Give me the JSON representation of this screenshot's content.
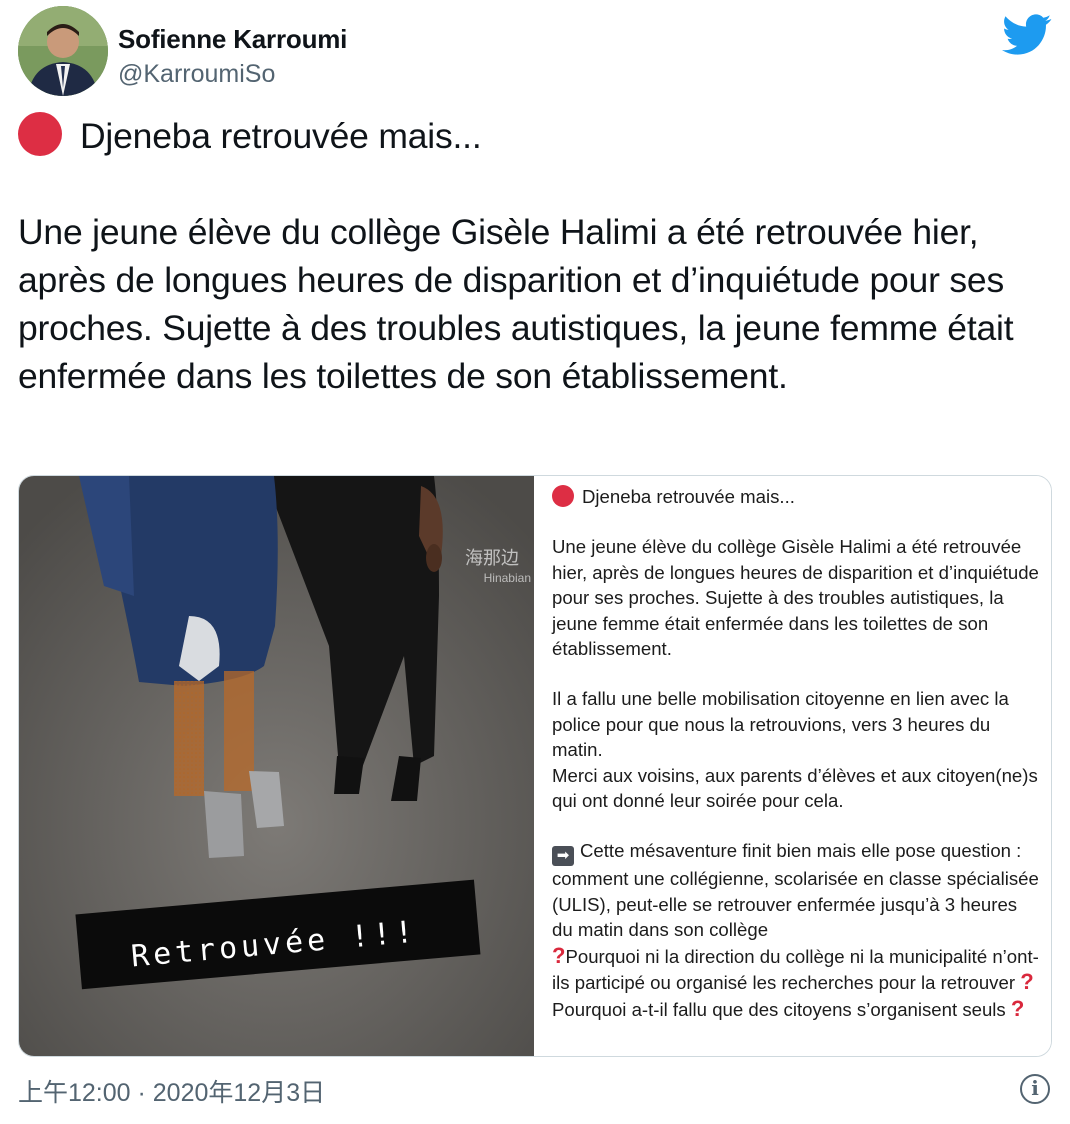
{
  "author": {
    "name": "Sofienne Karroumi",
    "handle": "@KarroumiSo"
  },
  "icons": {
    "logo": "twitter-bird-icon",
    "status": "red-circle-icon",
    "info": "info-icon"
  },
  "colors": {
    "twitter_blue": "#1d9bf0",
    "red_dot": "#dd2e44"
  },
  "tweet": {
    "line1": "Djeneba retrouvée mais...",
    "body": "Une jeune élève du collège Gisèle Halimi a été retrouvée hier, après de longues heures de disparition et d’inquiétude pour ses proches. Sujette à des troubles autistiques, la jeune femme était enfermée dans les toilettes de son établissement."
  },
  "media": {
    "photo_caption": "Retrouvée !!!",
    "watermark_cn": "海那边",
    "watermark_en": "Hinabian",
    "panel": {
      "title": "Djeneba retrouvée mais...",
      "p1": "Une jeune élève du collège Gisèle Halimi a été retrouvée hier, après de longues heures de disparition et d’inquiétude pour ses proches. Sujette à des troubles autistiques, la jeune femme était enfermée dans les toilettes de son établissement.",
      "p2": "Il a fallu une belle mobilisation citoyenne en lien avec la police pour que nous la retrouvions, vers 3 heures du matin.\nMerci aux voisins, aux parents d’élèves et aux citoyen(ne)s qui ont donné leur soirée pour cela.",
      "p3a": "Cette mésaventure finit bien mais elle pose question : comment une collégienne, scolarisée en classe spécialisée (ULIS), peut-elle se retrouver enfermée jusqu’à 3 heures du matin dans son collège",
      "q1": "Pourquoi ni la direction du collège ni la municipalité n’ont-ils participé ou organisé les recherches pour la retrouver",
      "q2": "Pourquoi a-t-il fallu que des citoyens s’organisent seuls"
    }
  },
  "footer": {
    "timestamp": "上午12:00 · 2020年12月3日"
  }
}
